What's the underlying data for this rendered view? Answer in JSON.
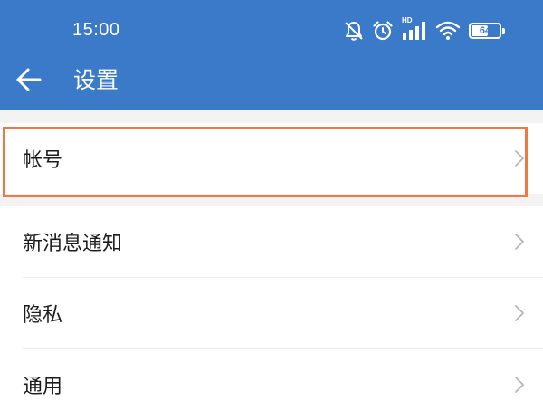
{
  "status_bar": {
    "time": "15:00",
    "icons": [
      "bell-off-icon",
      "alarm-icon",
      "signal-icon",
      "wifi-icon",
      "battery-icon"
    ],
    "signal_tag": "HD",
    "battery_level": "64",
    "battery_fraction": 0.64
  },
  "toolbar": {
    "back_icon": "arrow-left-icon",
    "title": "设置"
  },
  "settings": {
    "items": [
      {
        "label": "帐号",
        "icon": "chevron-right-icon"
      },
      {
        "label": "新消息通知",
        "icon": "chevron-right-icon"
      },
      {
        "label": "隐私",
        "icon": "chevron-right-icon"
      },
      {
        "label": "通用",
        "icon": "chevron-right-icon"
      }
    ]
  },
  "colors": {
    "header": "#3b79c9",
    "highlight": "#f07845",
    "divider": "#ececec",
    "section_gap": "#f3f3f3"
  }
}
